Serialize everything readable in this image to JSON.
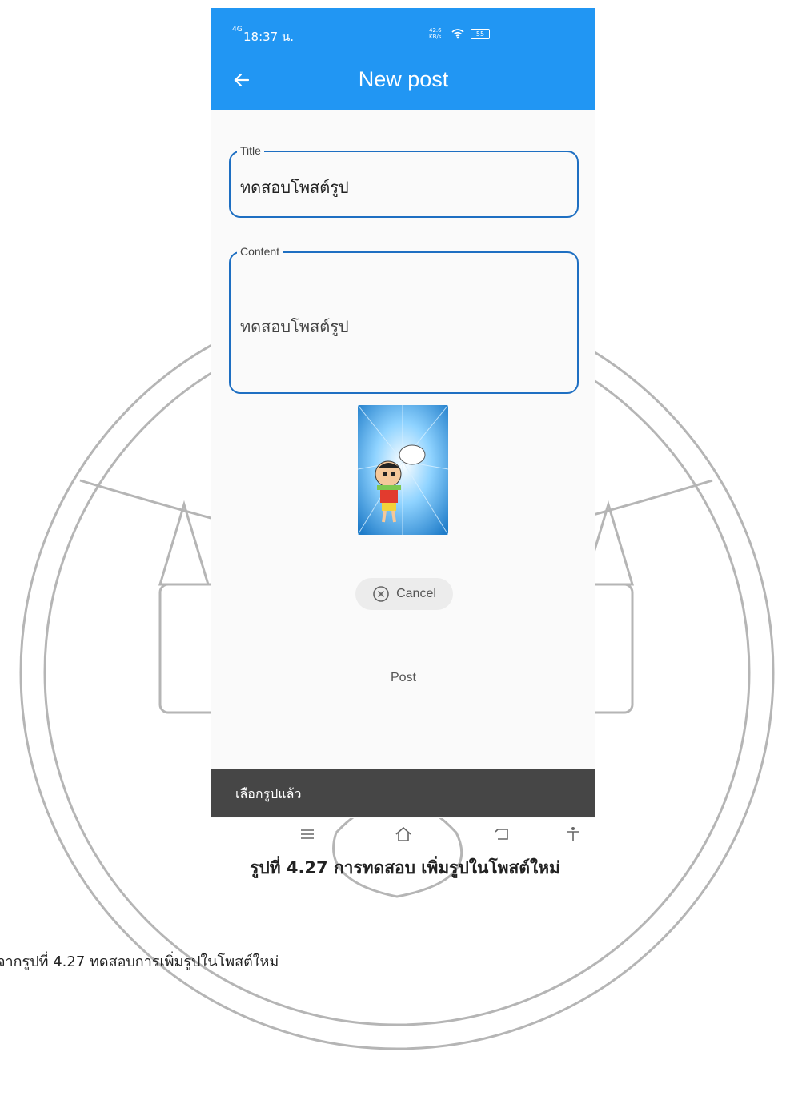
{
  "status_bar": {
    "signal": "4G",
    "time": "18:37 น.",
    "data_speed": "42.6 KB/s",
    "battery": "55"
  },
  "app_bar": {
    "title": "New post",
    "back_icon": "arrow-left-icon"
  },
  "form": {
    "title_label": "Title",
    "title_value": "ทดสอบโพสต์รูป",
    "content_label": "Content",
    "content_value": "ทดสอบโพสต์รูป"
  },
  "buttons": {
    "cancel_label": "Cancel",
    "post_label": "Post"
  },
  "snackbar": {
    "message": "เลือกรูปแล้ว"
  },
  "nav_icons": [
    "menu-icon",
    "home-icon",
    "back-icon",
    "accessibility-icon"
  ],
  "document": {
    "caption": "รูปที่ 4.27 การทดสอบ เพิ่มรูปในโพสต์ใหม่",
    "footer_text": "จากรูปที่ 4.27 ทดสอบการเพิ่มรูปในโพสต์ใหม่"
  },
  "colors": {
    "app_bar": "#2196f3",
    "field_border": "#1e6fc2",
    "snackbar": "#333333"
  }
}
